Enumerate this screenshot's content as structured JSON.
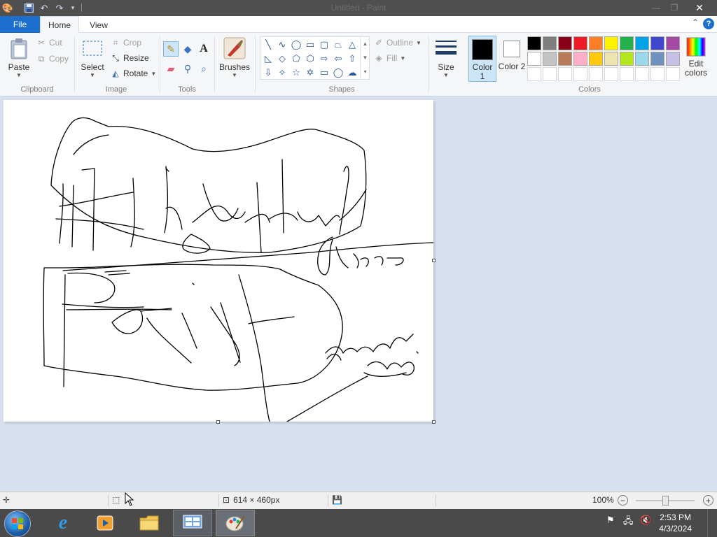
{
  "window": {
    "title": "Untitled - Paint",
    "minimize_glyph": "—",
    "maximize_glyph": "❐",
    "close_glyph": "✕"
  },
  "tabs": {
    "file": "File",
    "home": "Home",
    "view": "View"
  },
  "clipboard": {
    "paste": "Paste",
    "cut": "Cut",
    "copy": "Copy",
    "group_label": "Clipboard"
  },
  "image": {
    "select": "Select",
    "crop": "Crop",
    "resize": "Resize",
    "rotate": "Rotate",
    "group_label": "Image"
  },
  "tools": {
    "group_label": "Tools",
    "text_glyph": "A"
  },
  "brushes": {
    "label": "Brushes"
  },
  "shapes": {
    "outline": "Outline",
    "fill": "Fill",
    "group_label": "Shapes"
  },
  "size": {
    "label": "Size"
  },
  "colors": {
    "color1_label": "Color 1",
    "color2_label": "Color 2",
    "color1_value": "#000000",
    "color2_value": "#ffffff",
    "edit_colors": "Edit colors",
    "group_label": "Colors",
    "palette_row1": [
      "#000000",
      "#7f7f7f",
      "#880015",
      "#ed1c24",
      "#ff7f27",
      "#fff200",
      "#22b14c",
      "#00a2e8",
      "#3f48cc",
      "#a349a4"
    ],
    "palette_row2": [
      "#ffffff",
      "#c3c3c3",
      "#b97a57",
      "#ffaec9",
      "#ffc90e",
      "#efe4b0",
      "#b5e61d",
      "#99d9ea",
      "#7092be",
      "#c8bfe7"
    ]
  },
  "status": {
    "canvas_size": "614 × 460px",
    "zoom": "100%",
    "zoom_minus": "−",
    "zoom_plus": "+",
    "zoom_fraction": 0.5
  },
  "taskbar": {
    "time": "2:53 PM",
    "date": "4/3/2024"
  }
}
